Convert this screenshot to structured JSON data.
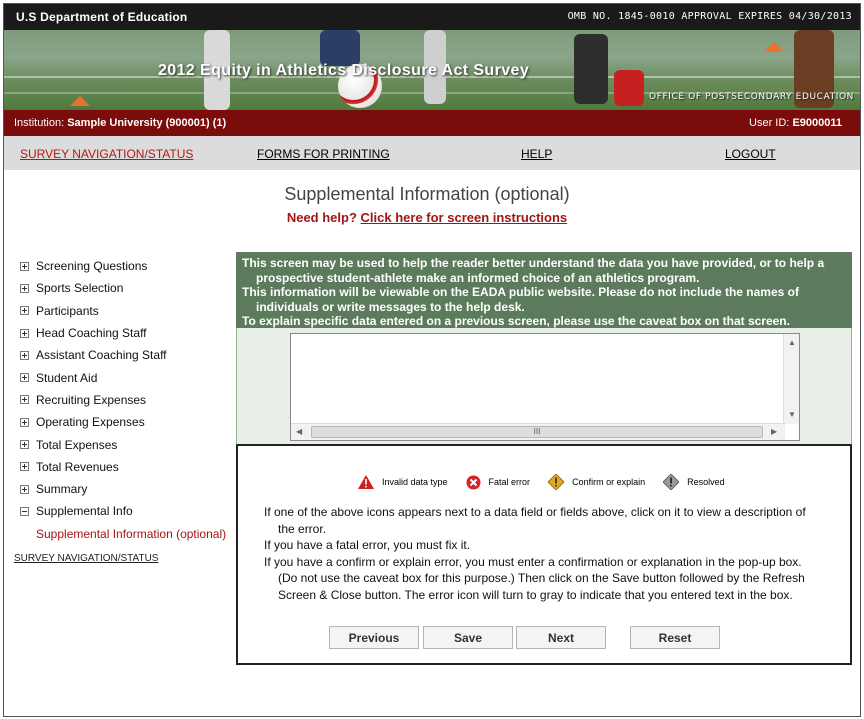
{
  "header": {
    "department": "U.S Department of Education",
    "omb": "OMB NO. 1845-0010 APPROVAL EXPIRES 04/30/2013",
    "banner_title": "2012 Equity in Athletics Disclosure Act Survey",
    "office": "OFFICE OF POSTSECONDARY EDUCATION"
  },
  "institution": {
    "label": "Institution:",
    "name": "Sample University (900001) (1)",
    "user_label": "User ID:",
    "user_id": "E9000011"
  },
  "nav": {
    "survey": "SURVEY NAVIGATION/STATUS",
    "forms": "FORMS FOR PRINTING",
    "help": "HELP",
    "logout": "LOGOUT"
  },
  "page": {
    "title": "Supplemental Information (optional)",
    "help_prefix": "Need help?",
    "help_link": "Click here for screen instructions"
  },
  "sidebar": {
    "items": [
      {
        "label": "Screening Questions"
      },
      {
        "label": "Sports Selection"
      },
      {
        "label": "Participants"
      },
      {
        "label": "Head Coaching Staff"
      },
      {
        "label": "Assistant Coaching Staff"
      },
      {
        "label": "Student Aid"
      },
      {
        "label": "Recruiting Expenses"
      },
      {
        "label": "Operating Expenses"
      },
      {
        "label": "Total Expenses"
      },
      {
        "label": "Total Revenues"
      },
      {
        "label": "Summary"
      },
      {
        "label": "Supplemental Info"
      }
    ],
    "sub_item": "Supplemental Information (optional)",
    "bottom_link": "SURVEY NAVIGATION/STATUS"
  },
  "info": {
    "line1": "This screen may be used to help the reader better understand the data you have provided, or to help a",
    "line2": "prospective student-athlete make an informed choice of an athletics program.",
    "line3": "This information will be viewable on the EADA public website. Please do not include the names of",
    "line4": "individuals or write messages to the help desk.",
    "line5": "To explain specific data entered on a previous screen, please use the caveat box on that screen."
  },
  "editor": {
    "value": "",
    "hscroll_grip": "III"
  },
  "legend": {
    "invalid": "Invalid data type",
    "fatal": "Fatal error",
    "confirm": "Confirm or explain",
    "resolved": "Resolved"
  },
  "notes": {
    "n1a": "If one of the above icons appears next to a data field or fields above, click on it to view a description of",
    "n1b": "the error.",
    "n2": "If you have a fatal error, you must fix it.",
    "n3a": "If you have a confirm or explain error, you must enter a confirmation or explanation in the pop-up box.",
    "n3b": "(Do not use the caveat box for this purpose.) Then click on the Save button followed by the Refresh",
    "n3c": "Screen & Close button. The error icon will turn to gray to indicate that you entered text in the box."
  },
  "buttons": {
    "previous": "Previous",
    "save": "Save",
    "next": "Next",
    "reset": "Reset"
  },
  "colors": {
    "institution_bar": "#7a0c0c",
    "info_panel": "#5c7b5c",
    "link_red": "#a31515"
  }
}
